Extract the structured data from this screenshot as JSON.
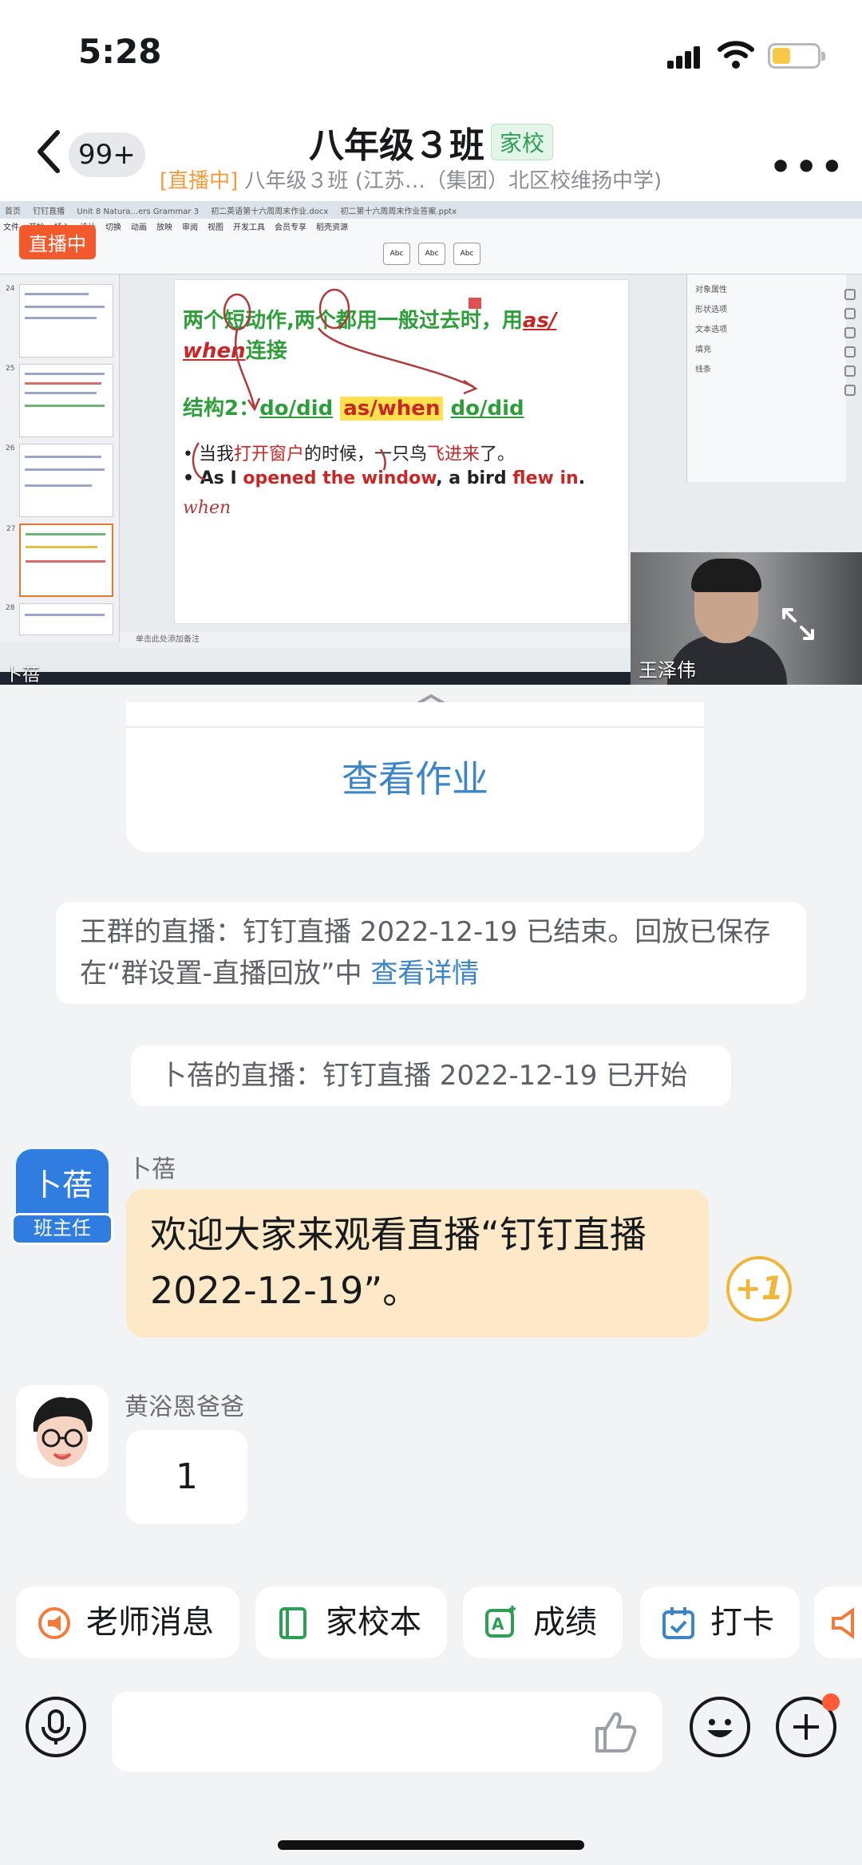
{
  "status": {
    "time": "5:28"
  },
  "header": {
    "unread_count": "99+",
    "title": "八年级３班",
    "tag": "家校",
    "live_prefix": "[直播中]",
    "subtitle_rest": " 八年级３班 (江苏…（集团）北区校维扬中学)"
  },
  "live": {
    "badge": "直播中",
    "presenter_name": "卜蓓",
    "camera_name": "王泽伟",
    "ppt": {
      "tabs": [
        "首页",
        "钉钉直播",
        "Unit 8 Natura...ers Grammar 3",
        "初二英语第十六周周末作业.docx",
        "初二第十六周周末作业答案.pptx"
      ],
      "ribbon_tabs": [
        "文件",
        "开始",
        "插入",
        "设计",
        "切换",
        "动画",
        "放映",
        "审阅",
        "视图",
        "开发工具",
        "会员专享",
        "稻壳资源"
      ],
      "style_samples": [
        "Abc",
        "Abc",
        "Abc"
      ],
      "slide": {
        "line1_a": "两个短动作,两个都用一般过去时，用",
        "line1_b": "as/",
        "line2_a": "when",
        "line2_b": "连接",
        "structure_label": "结构2：",
        "structure_a": "do/did",
        "structure_b": "as/when",
        "structure_c": "do/did",
        "cn_a": "当我",
        "cn_b": "打开窗户",
        "cn_c": "的时候，一只鸟",
        "cn_d": "飞进来",
        "cn_e": "了。",
        "en_a": "As I ",
        "en_b": "opened the window",
        "en_c": ", a bird ",
        "en_d": "flew in",
        "en_e": ".",
        "handwriting": "when"
      },
      "right_pane": [
        "对象属性",
        "形状选项",
        "文本选项",
        "填充",
        "线条"
      ],
      "footer": "单击此处添加备注",
      "thumb_numbers": [
        "24",
        "25",
        "26",
        "27",
        "28"
      ]
    }
  },
  "chat": {
    "homework_button": "查看作业",
    "system_msg_1": "王群的直播：钉钉直播 2022-12-19 已结束。回放已保存在“群设置-直播回放”中 ",
    "system_msg_1_link": "查看详情",
    "system_msg_2": "卜蓓的直播：钉钉直播 2022-12-19 已开始",
    "messages": [
      {
        "sender": "卜蓓",
        "avatar_text": "卜蓓",
        "role": "班主任",
        "text": "欢迎大家来观看直播“钉钉直播 2022-12-19”。",
        "reaction": "+1"
      },
      {
        "sender": "黄浴恩爸爸",
        "text": "1"
      }
    ]
  },
  "quick_actions": [
    "老师消息",
    "家校本",
    "成绩",
    "打卡"
  ],
  "input": {
    "placeholder": ""
  },
  "colors": {
    "accent_blue": "#3c85c6",
    "live_orange": "#f25a2e",
    "tag_green": "#2e9e55",
    "bubble_yellow": "#fde9c7"
  }
}
